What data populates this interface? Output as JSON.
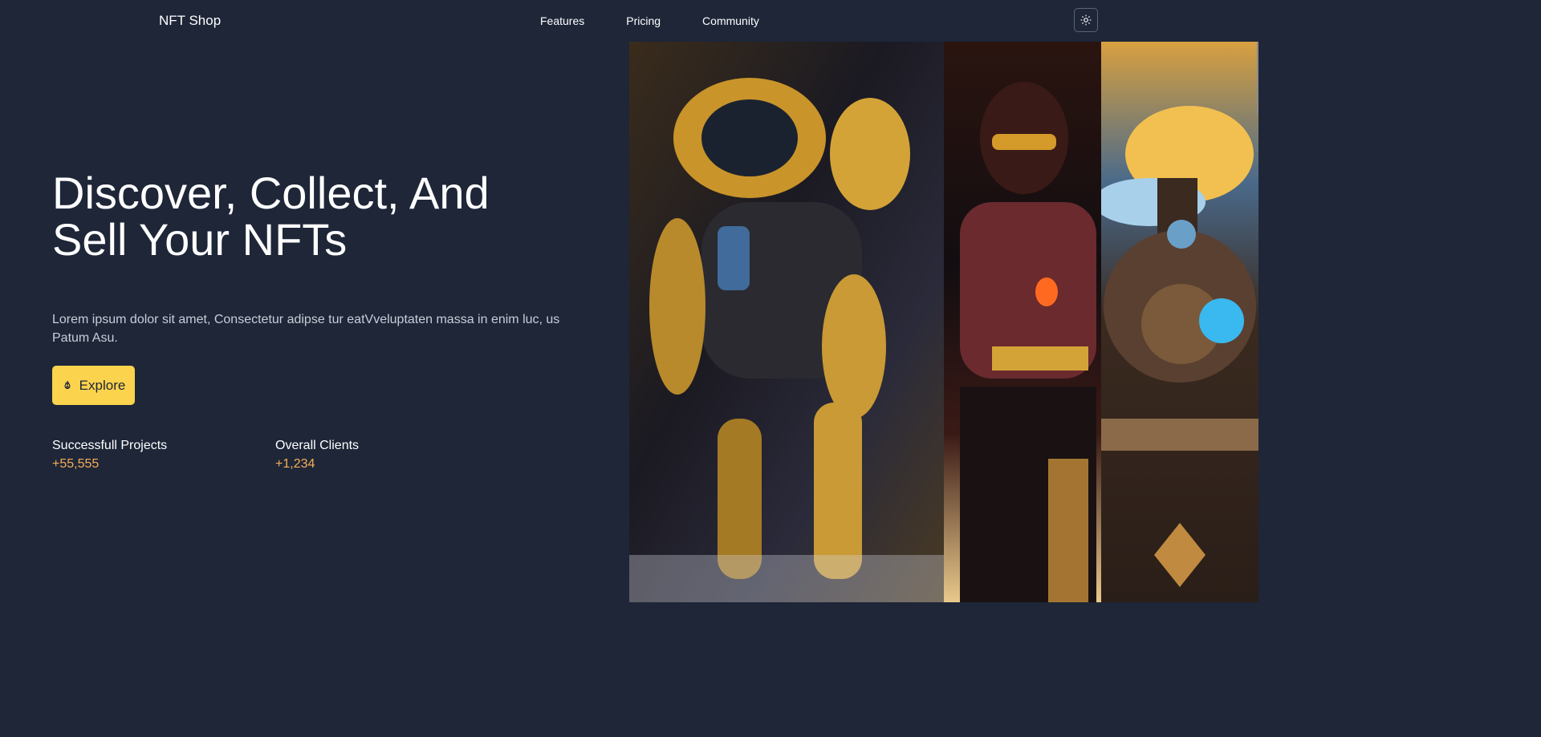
{
  "header": {
    "brand": "NFT Shop",
    "nav": [
      {
        "label": "Features"
      },
      {
        "label": "Pricing"
      },
      {
        "label": "Community"
      }
    ],
    "theme_toggle_icon": "sun-icon"
  },
  "hero": {
    "title_line1": "Discover, Collect, And",
    "title_line2": "Sell Your NFTs",
    "description": "Lorem ipsum dolor sit amet, Consectetur adipse tur eatVveluptaten massa in enim luc, us Patum Asu.",
    "explore_label": "Explore",
    "explore_icon": "fire-icon"
  },
  "stats": [
    {
      "label": "Successfull Projects",
      "value": "+55,555"
    },
    {
      "label": "Overall Clients",
      "value": "+1,234"
    }
  ],
  "colors": {
    "background": "#1e2638",
    "accent": "#fcd34d",
    "stat_value": "#f6ad55"
  }
}
